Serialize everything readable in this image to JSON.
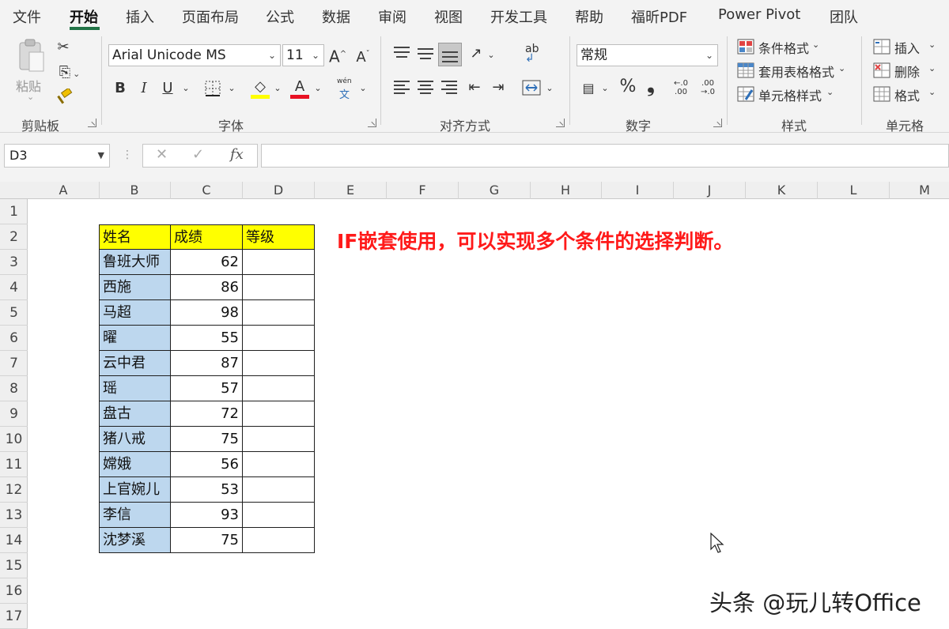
{
  "menu": {
    "tabs": [
      "文件",
      "开始",
      "插入",
      "页面布局",
      "公式",
      "数据",
      "审阅",
      "视图",
      "开发工具",
      "帮助",
      "福昕PDF",
      "Power Pivot",
      "团队"
    ],
    "active_index": 1
  },
  "ribbon": {
    "clipboard": {
      "paste_label": "粘贴",
      "group_label": "剪贴板"
    },
    "font": {
      "font_name": "Arial Unicode MS",
      "font_size": "11",
      "bold": "B",
      "italic": "I",
      "underline": "U",
      "grow": "A",
      "shrink": "A",
      "font_color_letter": "A",
      "phonetic_top": "wén",
      "phonetic_bottom": "文",
      "highlight_color": "#ffff00",
      "font_color": "#e81123",
      "group_label": "字体"
    },
    "alignment": {
      "wrap": "ab",
      "group_label": "对齐方式"
    },
    "number": {
      "format": "常规",
      "percent": "%",
      "comma": "❟",
      "inc_decimal": "←.0 .00",
      "dec_decimal": ".00 →.0",
      "group_label": "数字"
    },
    "styles": {
      "conditional_format": "条件格式",
      "table_format": "套用表格格式",
      "cell_styles": "单元格样式",
      "group_label": "样式"
    },
    "cells": {
      "insert": "插入",
      "delete": "删除",
      "format": "格式",
      "group_label": "单元格"
    }
  },
  "formula_bar": {
    "name_box": "D3",
    "cancel": "✕",
    "enter": "✓",
    "fx": "fx",
    "formula": ""
  },
  "sheet": {
    "columns": [
      "A",
      "B",
      "C",
      "D",
      "E",
      "F",
      "G",
      "H",
      "I",
      "J",
      "K",
      "L",
      "M"
    ],
    "rows": [
      "1",
      "2",
      "3",
      "4",
      "5",
      "6",
      "7",
      "8",
      "9",
      "10",
      "11",
      "12",
      "13",
      "14",
      "15",
      "16",
      "17"
    ],
    "header": {
      "name": "姓名",
      "score": "成绩",
      "grade": "等级"
    },
    "records": [
      {
        "name": "鲁班大师",
        "score": "62",
        "grade": ""
      },
      {
        "name": "西施",
        "score": "86",
        "grade": ""
      },
      {
        "name": "马超",
        "score": "98",
        "grade": ""
      },
      {
        "name": "曜",
        "score": "55",
        "grade": ""
      },
      {
        "name": "云中君",
        "score": "87",
        "grade": ""
      },
      {
        "name": "瑶",
        "score": "57",
        "grade": ""
      },
      {
        "name": "盘古",
        "score": "72",
        "grade": ""
      },
      {
        "name": "猪八戒",
        "score": "75",
        "grade": ""
      },
      {
        "name": "嫦娥",
        "score": "56",
        "grade": ""
      },
      {
        "name": "上官婉儿",
        "score": "53",
        "grade": ""
      },
      {
        "name": "李信",
        "score": "93",
        "grade": ""
      },
      {
        "name": "沈梦溪",
        "score": "75",
        "grade": ""
      }
    ],
    "note": "IF嵌套使用，可以实现多个条件的选择判断。",
    "colors": {
      "name_fill": "#bdd7ee",
      "header_fill": "#ffff00",
      "note": "#ff1a1a"
    }
  },
  "watermark": "头条 @玩儿转Office"
}
